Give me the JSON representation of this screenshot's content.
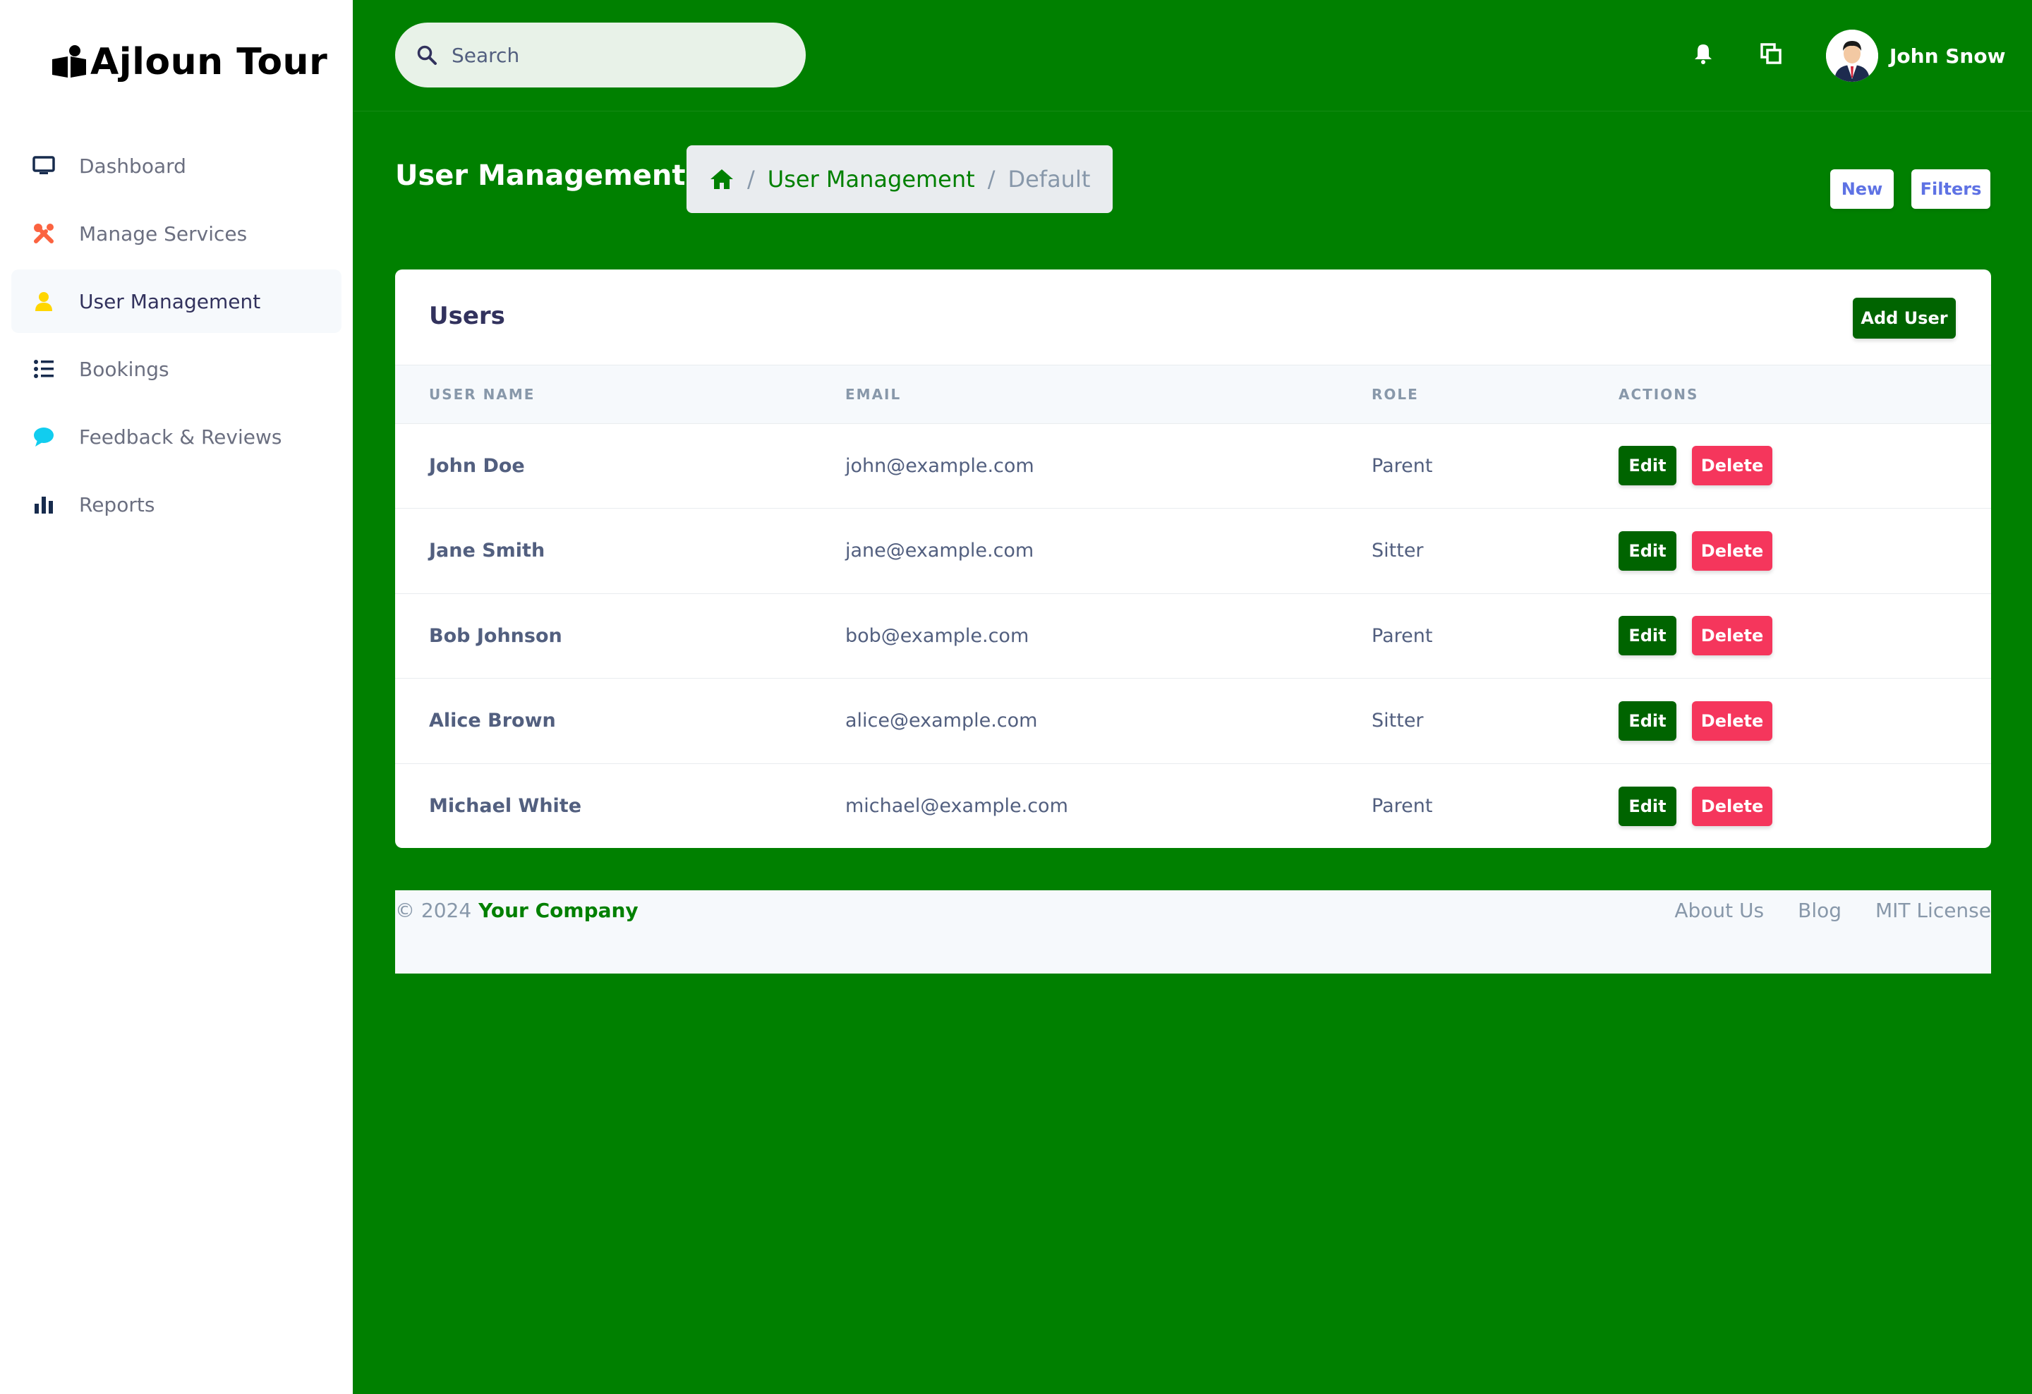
{
  "app": {
    "brand": "Ajloun Tour"
  },
  "sidebar": {
    "items": [
      {
        "label": "Dashboard",
        "icon": "monitor-icon",
        "color": "#172b4d"
      },
      {
        "label": "Manage Services",
        "icon": "tools-icon",
        "color": "#fb6340"
      },
      {
        "label": "User Management",
        "icon": "user-icon",
        "color": "#ffd600",
        "active": true
      },
      {
        "label": "Bookings",
        "icon": "list-icon",
        "color": "#172b4d"
      },
      {
        "label": "Feedback & Reviews",
        "icon": "chat-bubble-icon",
        "color": "#11cdef"
      },
      {
        "label": "Reports",
        "icon": "bar-chart-icon",
        "color": "#172b4d"
      }
    ]
  },
  "topbar": {
    "search_placeholder": "Search",
    "user_name": "John Snow"
  },
  "header": {
    "title": "User Management",
    "breadcrumb": [
      "User Management",
      "Default"
    ],
    "new_label": "New",
    "filters_label": "Filters"
  },
  "users_card": {
    "title": "Users",
    "add_label": "Add User",
    "columns": [
      "User Name",
      "Email",
      "Role",
      "Actions"
    ],
    "rows": [
      {
        "name": "John Doe",
        "email": "john@example.com",
        "role": "Parent"
      },
      {
        "name": "Jane Smith",
        "email": "jane@example.com",
        "role": "Sitter"
      },
      {
        "name": "Bob Johnson",
        "email": "bob@example.com",
        "role": "Parent"
      },
      {
        "name": "Alice Brown",
        "email": "alice@example.com",
        "role": "Sitter"
      },
      {
        "name": "Michael White",
        "email": "michael@example.com",
        "role": "Parent"
      }
    ],
    "edit_label": "Edit",
    "delete_label": "Delete"
  },
  "footer": {
    "copyright": "© 2024",
    "company": "Your Company",
    "links": [
      "About Us",
      "Blog",
      "MIT License"
    ]
  },
  "colors": {
    "background": "#008000",
    "edit_button": "#006400",
    "delete_button": "#f5365c",
    "accent_link": "#5e72e4"
  }
}
